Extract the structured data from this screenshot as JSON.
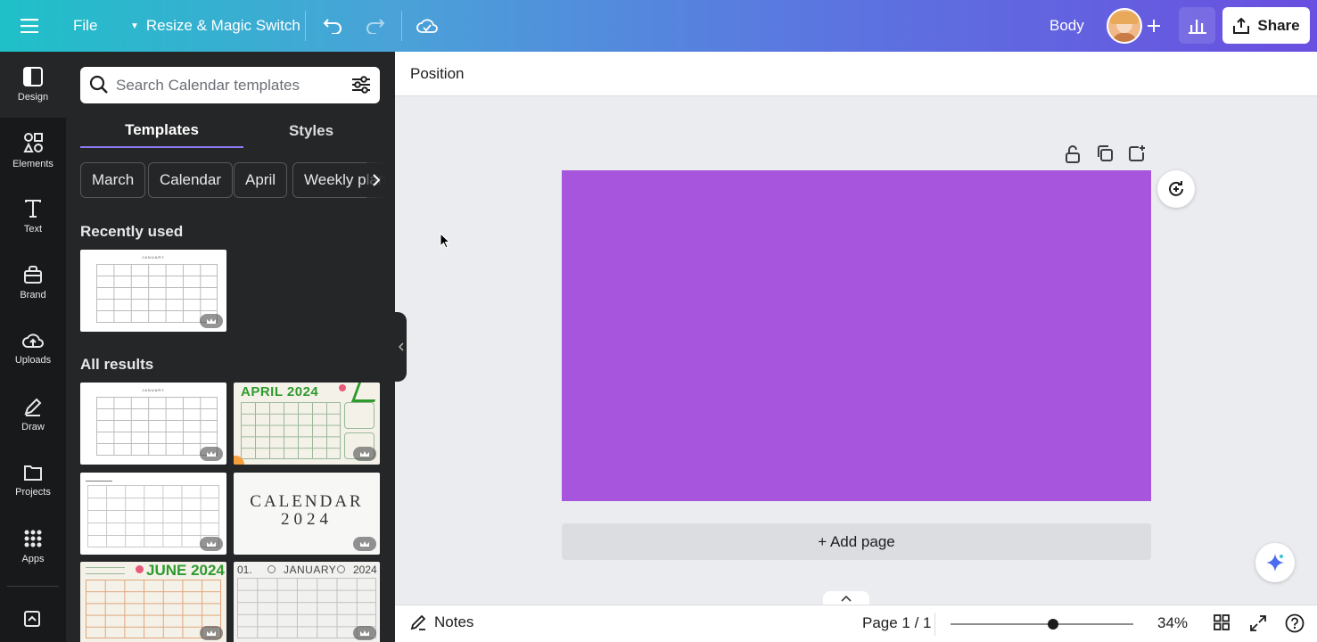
{
  "topbar": {
    "file_label": "File",
    "resize_label": "Resize & Magic Switch",
    "font_label": "Body",
    "share_label": "Share",
    "icons": [
      "menu-icon",
      "undo-icon",
      "redo-icon",
      "cloud-save-icon",
      "plus-icon",
      "analytics-icon",
      "share-icon"
    ]
  },
  "rail": {
    "items": [
      {
        "label": "Design",
        "icon": "design-icon"
      },
      {
        "label": "Elements",
        "icon": "elements-icon"
      },
      {
        "label": "Text",
        "icon": "text-icon"
      },
      {
        "label": "Brand",
        "icon": "brand-icon"
      },
      {
        "label": "Uploads",
        "icon": "uploads-icon"
      },
      {
        "label": "Draw",
        "icon": "draw-icon"
      },
      {
        "label": "Projects",
        "icon": "projects-icon"
      },
      {
        "label": "Apps",
        "icon": "apps-icon"
      }
    ]
  },
  "panel": {
    "search_placeholder": "Search Calendar templates",
    "tabs": [
      "Templates",
      "Styles"
    ],
    "chips": [
      "March",
      "Calendar",
      "April",
      "Weekly plan"
    ],
    "recently_used_title": "Recently used",
    "all_results_title": "All results",
    "thumb_texts": {
      "january": "JANUARY",
      "april": "APRIL 2024",
      "calendar": "CALENDAR",
      "calendar_year": "2024",
      "june": "JUNE 2024",
      "jan_num": "01.",
      "jan_word": "JANUARY",
      "jan_year": "2024"
    }
  },
  "workspace": {
    "position_label": "Position",
    "add_page_label": "+ Add page",
    "notes_label": "Notes",
    "page_indicator": "Page 1 / 1",
    "zoom_label": "34%",
    "zoom_fraction": 0.34,
    "page_color": "#a655dc"
  }
}
